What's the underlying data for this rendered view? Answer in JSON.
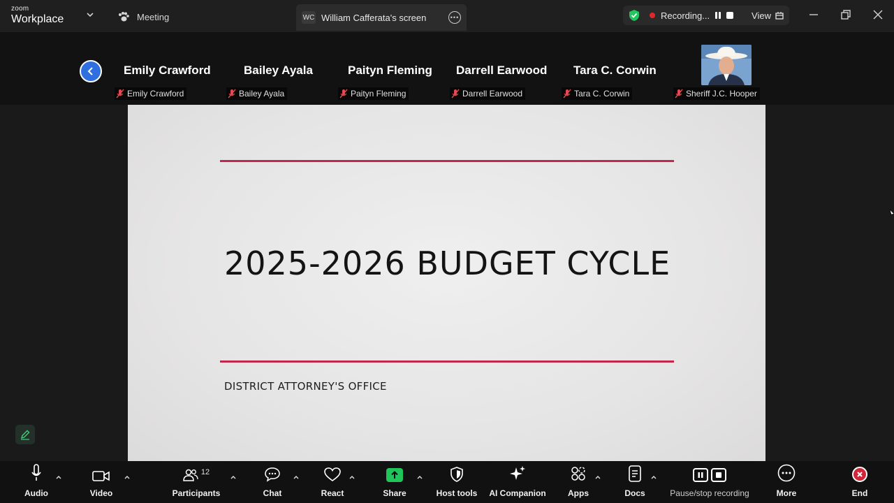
{
  "app": {
    "brand_small": "zoom",
    "brand_large": "Workplace"
  },
  "tabs": {
    "meeting_label": "Meeting",
    "screen_initials": "WC",
    "screen_label": "William Cafferata's screen"
  },
  "recording": {
    "status": "Recording...",
    "view_label": "View"
  },
  "participants_strip": {
    "names_large": [
      "Emily Crawford",
      "Bailey Ayala",
      "Paityn Fleming",
      "Darrell Earwood",
      "Tara C. Corwin"
    ],
    "labels_small": [
      "Emily Crawford",
      "Bailey Ayala",
      "Paityn Fleming",
      "Darrell Earwood",
      "Tara C. Corwin",
      "Sheriff J.C. Hooper"
    ]
  },
  "slide": {
    "title": "2025-2026 BUDGET CYCLE",
    "subtitle": "DISTRICT ATTORNEY'S OFFICE"
  },
  "toolbar": {
    "audio": "Audio",
    "video": "Video",
    "participants": "Participants",
    "participants_count": "12",
    "chat": "Chat",
    "react": "React",
    "share": "Share",
    "host_tools": "Host tools",
    "ai_companion": "AI Companion",
    "apps": "Apps",
    "docs": "Docs",
    "pause_stop": "Pause/stop recording",
    "more": "More",
    "end": "End"
  },
  "colors": {
    "accent_blue": "#2f6fe0",
    "share_green": "#21c35b",
    "end_red": "#d0263a",
    "slide_rule": "#c0284c",
    "secure_green": "#22c55e"
  }
}
